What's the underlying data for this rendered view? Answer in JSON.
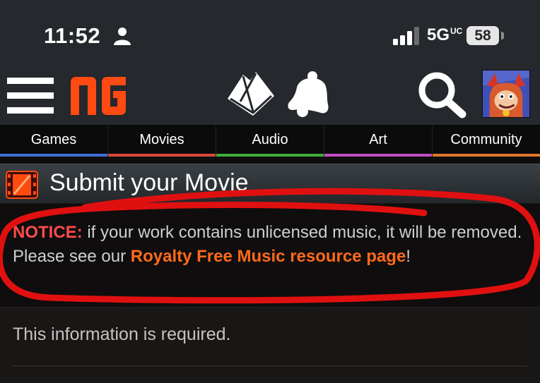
{
  "status": {
    "time": "11:52",
    "network": "5G",
    "network_suffix": "UC",
    "battery": "58"
  },
  "header": {
    "logo": "NG"
  },
  "nav": {
    "items": [
      {
        "label": "Games",
        "color": "#3f6fd6"
      },
      {
        "label": "Movies",
        "color": "#d64a3a"
      },
      {
        "label": "Audio",
        "color": "#3fae3a"
      },
      {
        "label": "Art",
        "color": "#c24dc4"
      },
      {
        "label": "Community",
        "color": "#e0752a"
      }
    ]
  },
  "page": {
    "title": "Submit your Movie"
  },
  "notice": {
    "label": "NOTICE:",
    "text_before": " if your work contains unlicensed music, it will be removed. Please see our ",
    "link": "Royalty Free Music resource page",
    "text_after": "!"
  },
  "form": {
    "required_message": "This information is required."
  },
  "colors": {
    "notice_label": "#ff4b4b",
    "link": "#ff6a1a",
    "annotation": "#e01010"
  },
  "icons": [
    "person-icon",
    "signal-icon",
    "menu-icon",
    "inbox-icon",
    "bell-icon",
    "search-icon",
    "film-icon"
  ]
}
